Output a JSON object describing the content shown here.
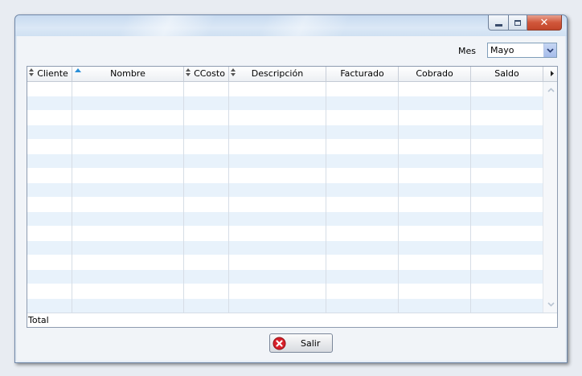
{
  "window": {
    "title": "",
    "caption_buttons": {
      "minimize": "minimize-icon",
      "maximize": "maximize-icon",
      "close": "close-icon"
    }
  },
  "filter": {
    "label": "Mes",
    "selected_month": "Mayo"
  },
  "grid": {
    "columns": [
      {
        "label": "Cliente",
        "sort": "sortable"
      },
      {
        "label": "Nombre",
        "sort": "ascending"
      },
      {
        "label": "CCosto",
        "sort": "sortable"
      },
      {
        "label": "Descripción",
        "sort": "sortable"
      },
      {
        "label": "Facturado",
        "sort": "none"
      },
      {
        "label": "Cobrado",
        "sort": "none"
      },
      {
        "label": "Saldo",
        "sort": "none"
      }
    ],
    "rows": [],
    "visible_empty_rows": 16,
    "total_label": "Total"
  },
  "actions": {
    "exit_label": "Salir",
    "exit_icon": "cancel-icon"
  },
  "colors": {
    "row_alt": "#e8f2fb",
    "titlebar": "#c7daf0",
    "close_button": "#c2452a",
    "sort_indicator": "#2b8fd8"
  }
}
